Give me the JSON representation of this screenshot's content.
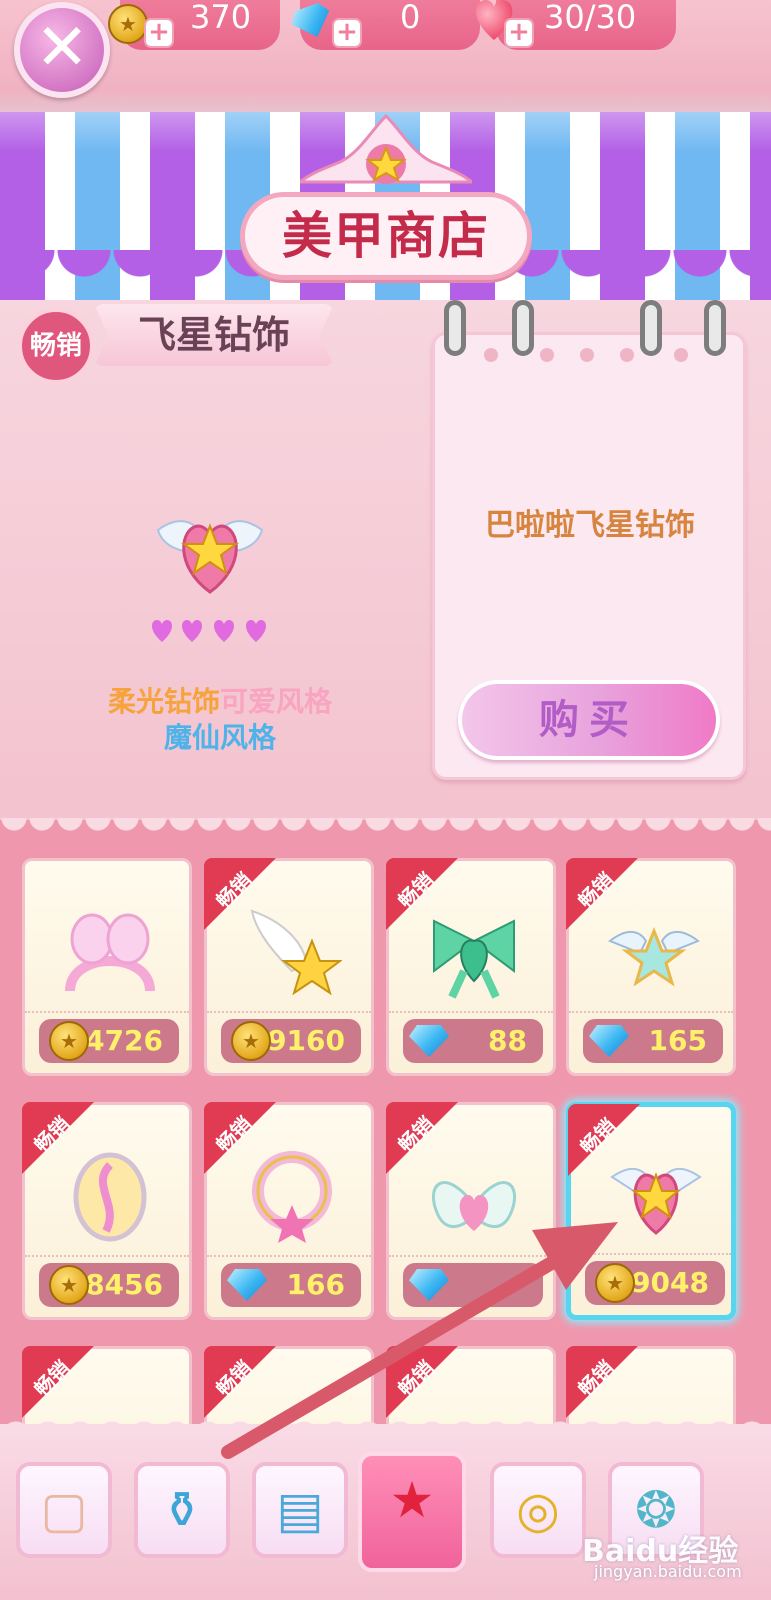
{
  "resources": {
    "coins": "370",
    "gems": "0",
    "hearts": "30/30",
    "plus": "+"
  },
  "close": {
    "icon": "close-icon",
    "glyph": "✕"
  },
  "shop": {
    "title": "美甲商店"
  },
  "featured": {
    "badge": "畅销",
    "category": "飞星钻饰",
    "name": "巴啦啦飞星钻饰",
    "rating_hearts": 4,
    "tag_line1_a": "柔光钻饰",
    "tag_line1_b": "可爱风格",
    "tag_line2": "魔仙风格",
    "buy_label": "购买"
  },
  "items": [
    {
      "icon": "ear-headband-icon",
      "currency": "coin",
      "price": "4726",
      "hot": false
    },
    {
      "icon": "winged-star-icon",
      "currency": "coin",
      "price": "9160",
      "hot": true,
      "hot_label": "畅销"
    },
    {
      "icon": "green-bow-icon",
      "currency": "gem",
      "price": "88",
      "hot": true,
      "hot_label": "畅销"
    },
    {
      "icon": "winged-star-tiara-icon",
      "currency": "gem",
      "price": "165",
      "hot": true,
      "hot_label": "畅销"
    },
    {
      "icon": "pink-egg-icon",
      "currency": "coin",
      "price": "8456",
      "hot": true,
      "hot_label": "畅销"
    },
    {
      "icon": "star-wreath-icon",
      "currency": "gem",
      "price": "166",
      "hot": true,
      "hot_label": "畅销"
    },
    {
      "icon": "butterfly-heart-icon",
      "currency": "gem",
      "price": "",
      "hot": true,
      "hot_label": "畅销"
    },
    {
      "icon": "winged-heart-star-icon",
      "currency": "coin",
      "price": "9048",
      "hot": true,
      "hot_label": "畅销",
      "selected": true
    },
    {
      "icon": "bow-tiara-icon",
      "currency": "",
      "price": "",
      "hot": true,
      "hot_label": "畅销"
    },
    {
      "icon": "blue-bow-tiara-icon",
      "currency": "",
      "price": "",
      "hot": true,
      "hot_label": "畅销"
    },
    {
      "icon": "gold-bow-tiara-icon",
      "currency": "",
      "price": "",
      "hot": true,
      "hot_label": "畅销"
    },
    {
      "icon": "teal-bow-tiara-icon",
      "currency": "",
      "price": "",
      "hot": true,
      "hot_label": "畅销"
    }
  ],
  "tabs": [
    {
      "icon": "nail-patch-icon",
      "selected": false
    },
    {
      "icon": "polish-bottle-icon",
      "selected": false
    },
    {
      "icon": "pattern-paper-icon",
      "selected": false
    },
    {
      "icon": "star-gem-icon",
      "selected": true
    },
    {
      "icon": "ring-icon",
      "selected": false
    },
    {
      "icon": "pearl-bracelet-icon",
      "selected": false
    }
  ],
  "watermark": {
    "brand": "Baidu经验",
    "url": "jingyan.baidu.com"
  },
  "colors": {
    "accent": "#e0577d",
    "price_text": "#fff16a",
    "selected_border": "#58d6f0",
    "arrow": "#d85a6a"
  }
}
